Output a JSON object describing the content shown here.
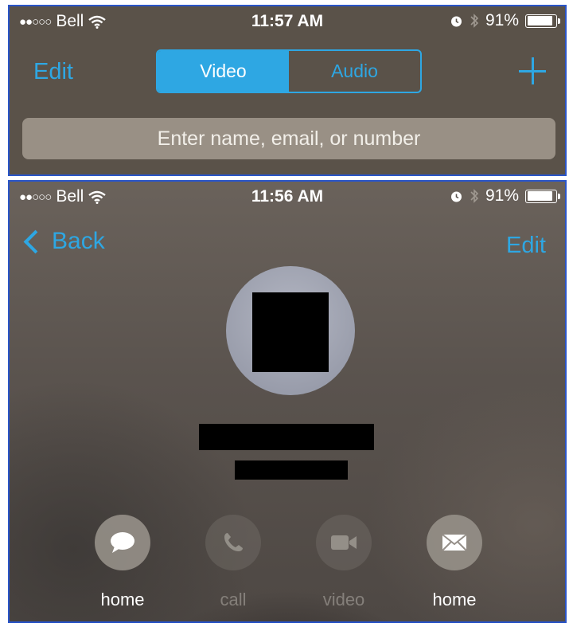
{
  "top_screen": {
    "status": {
      "carrier": "Bell",
      "signal": "●●○○○",
      "time": "11:57 AM",
      "battery_text": "91%",
      "battery_level": 0.91
    },
    "nav": {
      "edit_label": "Edit",
      "segments": [
        {
          "label": "Video",
          "active": true
        },
        {
          "label": "Audio",
          "active": false
        }
      ]
    },
    "search": {
      "placeholder": "Enter name, email, or number"
    }
  },
  "bottom_screen": {
    "status": {
      "carrier": "Bell",
      "signal": "●●○○○",
      "time": "11:56 AM",
      "battery_text": "91%",
      "battery_level": 0.91
    },
    "nav": {
      "back_label": "Back",
      "edit_label": "Edit"
    },
    "actions": [
      {
        "icon": "message-bubble-icon",
        "label": "home",
        "enabled": true
      },
      {
        "icon": "phone-icon",
        "label": "call",
        "enabled": false
      },
      {
        "icon": "video-camera-icon",
        "label": "video",
        "enabled": false
      },
      {
        "icon": "envelope-icon",
        "label": "home",
        "enabled": true
      }
    ]
  },
  "colors": {
    "accent": "#2ea7e3",
    "frame_border": "#2a55c8"
  }
}
